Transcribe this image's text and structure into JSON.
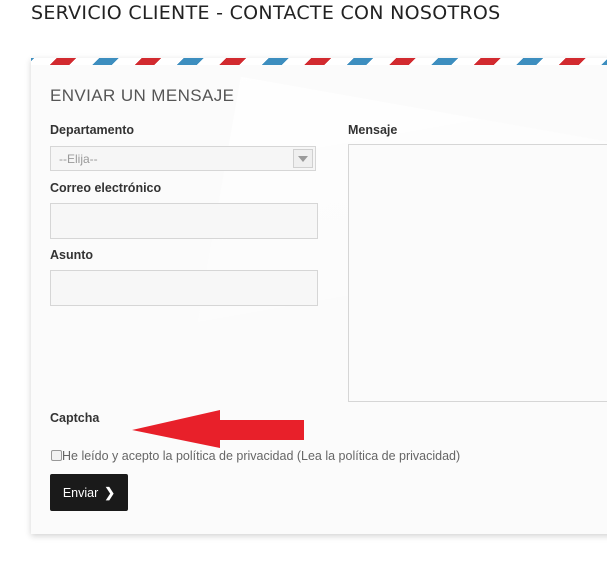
{
  "page_title": "SERVICIO CLIENTE - CONTACTE CON NOSOTROS",
  "form": {
    "title": "ENVIAR UN MENSAJE",
    "department": {
      "label": "Departamento",
      "selected": "--Elija--"
    },
    "email": {
      "label": "Correo electrónico",
      "value": ""
    },
    "subject": {
      "label": "Asunto",
      "value": ""
    },
    "message": {
      "label": "Mensaje",
      "value": ""
    },
    "captcha": {
      "label": "Captcha"
    },
    "privacy": {
      "text": "He leído y acepto la política de privacidad (Lea la política de privacidad)",
      "checked": false
    },
    "submit_label": "Enviar",
    "submit_icon": "chevron-right-icon"
  },
  "colors": {
    "airmail_blue": "#3d8ebf",
    "airmail_red": "#d22a2f",
    "annotation_arrow": "#e8202a",
    "button_bg": "#1a1a1a"
  },
  "annotation": {
    "icon": "red-arrow-pointing-left"
  }
}
